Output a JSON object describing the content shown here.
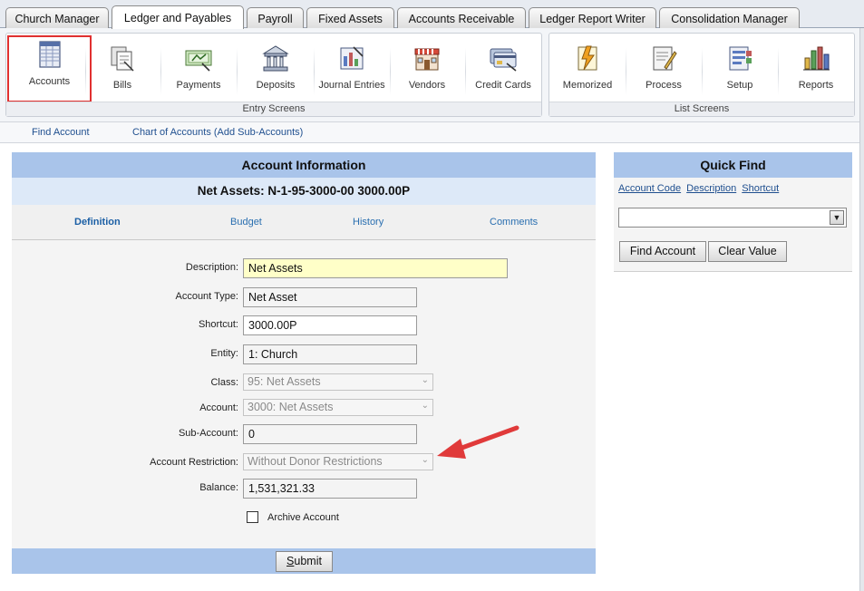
{
  "tabs": [
    {
      "label": "Church Manager"
    },
    {
      "label": "Ledger and Payables"
    },
    {
      "label": "Payroll"
    },
    {
      "label": "Fixed Assets"
    },
    {
      "label": "Accounts Receivable"
    },
    {
      "label": "Ledger Report Writer"
    },
    {
      "label": "Consolidation Manager"
    }
  ],
  "active_tab": "Ledger and Payables",
  "toolbar": {
    "entry_label": "Entry Screens",
    "list_label": "List Screens",
    "entry_tools": [
      {
        "label": "Accounts",
        "icon": "accounts-icon"
      },
      {
        "label": "Bills",
        "icon": "bills-icon"
      },
      {
        "label": "Payments",
        "icon": "payments-icon"
      },
      {
        "label": "Deposits",
        "icon": "deposits-icon"
      },
      {
        "label": "Journal Entries",
        "icon": "journal-entries-icon"
      },
      {
        "label": "Vendors",
        "icon": "vendors-icon"
      },
      {
        "label": "Credit Cards",
        "icon": "credit-cards-icon"
      }
    ],
    "list_tools": [
      {
        "label": "Memorized",
        "icon": "memorized-icon"
      },
      {
        "label": "Process",
        "icon": "process-icon"
      },
      {
        "label": "Setup",
        "icon": "setup-icon"
      },
      {
        "label": "Reports",
        "icon": "reports-icon"
      }
    ]
  },
  "subnav": {
    "find_account": "Find Account",
    "chart_of_accounts": "Chart of Accounts (Add Sub-Accounts)"
  },
  "account": {
    "title": "Account Information",
    "subtitle": "Net Assets: N-1-95-3000-00 3000.00P",
    "tabs": [
      "Definition",
      "Budget",
      "History",
      "Comments"
    ],
    "active_tab": "Definition",
    "fields": {
      "description": {
        "label": "Description:",
        "value": "Net Assets"
      },
      "account_type": {
        "label": "Account Type:",
        "value": "Net Asset"
      },
      "shortcut": {
        "label": "Shortcut:",
        "value": "3000.00P"
      },
      "entity": {
        "label": "Entity:",
        "value": "1: Church"
      },
      "class": {
        "label": "Class:",
        "value": "95: Net Assets"
      },
      "account": {
        "label": "Account:",
        "value": "3000: Net Assets"
      },
      "sub_account": {
        "label": "Sub-Account:",
        "value": "0"
      },
      "restriction": {
        "label": "Account Restriction:",
        "value": "Without Donor Restrictions"
      },
      "balance": {
        "label": "Balance:",
        "value": "1,531,321.33"
      }
    },
    "archive_label": "Archive Account",
    "archive_checked": false,
    "submit_label": "Submit"
  },
  "quick_find": {
    "title": "Quick Find",
    "links": [
      "Account Code",
      "Description",
      "Shortcut"
    ],
    "select_value": "",
    "find_button": "Find Account",
    "clear_button": "Clear Value"
  },
  "colors": {
    "panel_header": "#a9c4ea",
    "panel_sub": "#dde9f8",
    "highlight_input": "#ffffc8",
    "annotation_arrow": "#e03a3a",
    "selected_outline": "#e03030"
  }
}
